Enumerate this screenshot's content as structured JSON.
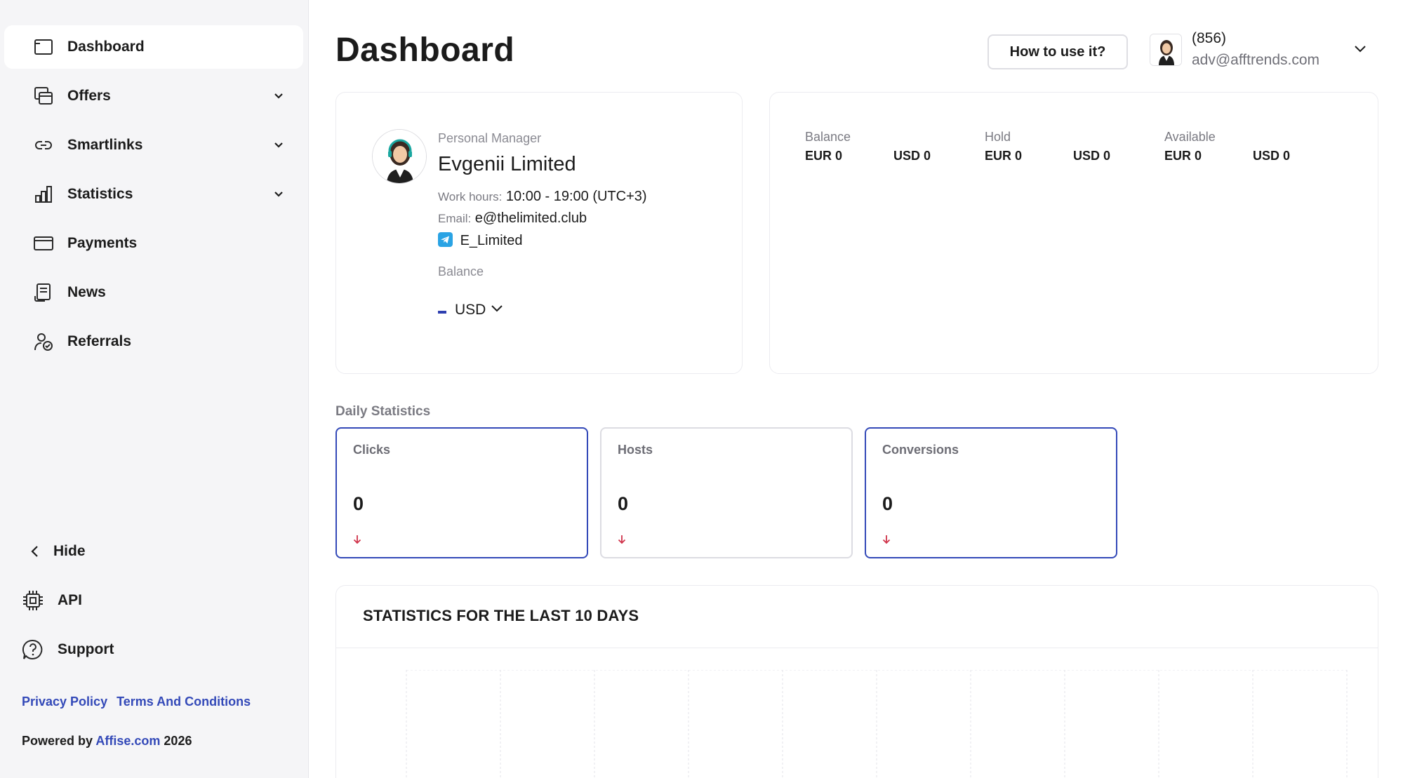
{
  "sidebar": {
    "nav": [
      {
        "label": "Dashboard",
        "icon": "dashboard-icon",
        "active": true,
        "expandable": false
      },
      {
        "label": "Offers",
        "icon": "offers-icon",
        "active": false,
        "expandable": true
      },
      {
        "label": "Smartlinks",
        "icon": "link-icon",
        "active": false,
        "expandable": true
      },
      {
        "label": "Statistics",
        "icon": "bar-chart-icon",
        "active": false,
        "expandable": true
      },
      {
        "label": "Payments",
        "icon": "card-icon",
        "active": false,
        "expandable": false
      },
      {
        "label": "News",
        "icon": "news-icon",
        "active": false,
        "expandable": false
      },
      {
        "label": "Referrals",
        "icon": "referral-icon",
        "active": false,
        "expandable": false
      }
    ],
    "hide_label": "Hide",
    "api_label": "API",
    "support_label": "Support",
    "privacy_label": "Privacy Policy",
    "terms_label": "Terms And Conditions",
    "powered_by_prefix": "Powered by",
    "powered_by_link": "Affise.com",
    "powered_by_year": "2026"
  },
  "header": {
    "title": "Dashboard",
    "howto_label": "How to use it?",
    "user_id": "(856)",
    "user_email": "adv@afftrends.com"
  },
  "manager": {
    "label": "Personal Manager",
    "name": "Evgenii Limited",
    "work_hours_key": "Work hours:",
    "work_hours": "10:00 - 19:00 (UTC+3)",
    "email_key": "Email:",
    "email": "e@thelimited.club",
    "telegram": "E_Limited",
    "balance_label": "Balance",
    "currency": "USD"
  },
  "balances": [
    {
      "title": "Balance",
      "eur": "EUR 0",
      "usd": "USD 0"
    },
    {
      "title": "Hold",
      "eur": "EUR 0",
      "usd": "USD 0"
    },
    {
      "title": "Available",
      "eur": "EUR 0",
      "usd": "USD 0"
    }
  ],
  "daily": {
    "label": "Daily Statistics",
    "cards": [
      {
        "title": "Clicks",
        "value": "0"
      },
      {
        "title": "Hosts",
        "value": "0"
      },
      {
        "title": "Conversions",
        "value": "0"
      }
    ]
  },
  "chart": {
    "title": "STATISTICS FOR THE LAST 10 DAYS"
  },
  "colors": {
    "accent": "#3349b8",
    "down_arrow": "#d0334a",
    "sidebar_bg": "#f5f5f7"
  }
}
